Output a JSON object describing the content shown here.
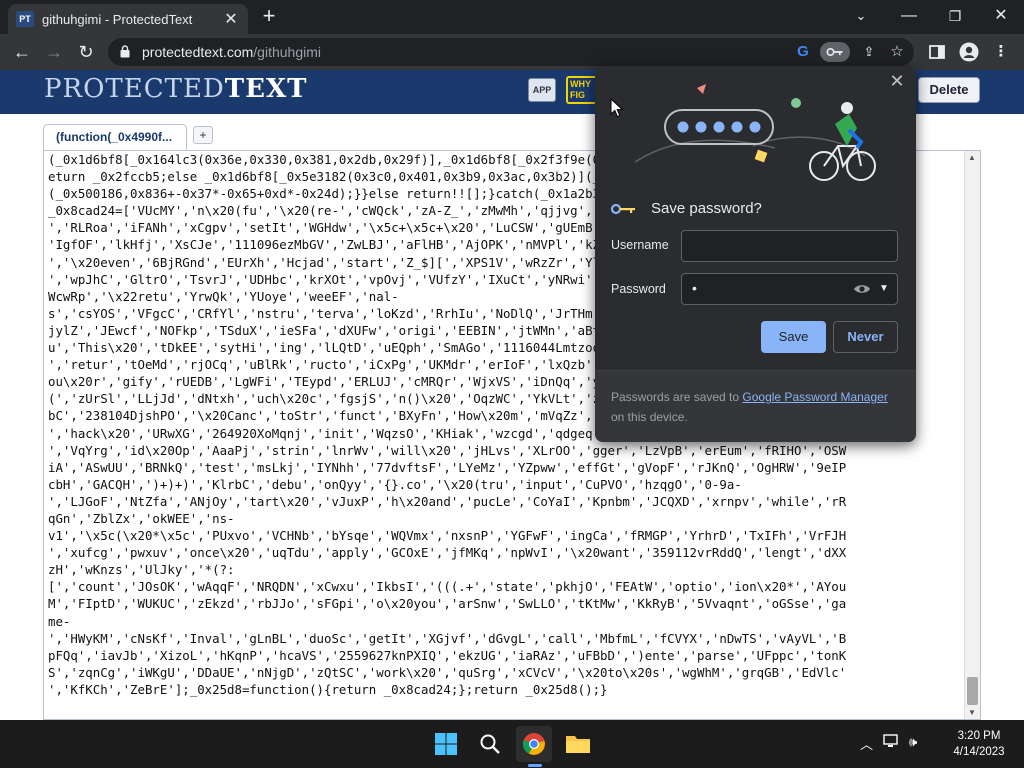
{
  "browser": {
    "tab_title": "githuhgimi - ProtectedText",
    "tab_favicon_text": "PT",
    "url_host": "protectedtext.com",
    "url_path": "/githuhgimi"
  },
  "site": {
    "logo_light": "PROTECTED",
    "logo_bold": "TEXT",
    "app_badge": "APP",
    "why_badge_line1": "WHY",
    "why_badge_line2": "FIG",
    "delete_label": "Delete",
    "doc_tab_label": "(function(_0x4990f...",
    "add_tab_label": "+"
  },
  "code_lines": [
    "(_0x1d6bf8[_0x164lc3(0x36e,0x330,0x381,0x2db,0x29f)],_0x1d6bf8[_0x2f3f9e(0x1,0x1,0x1)](_0x4f4f44))r",
    "eturn _0x2fccb5;else _0x1d6bf8[_0x5e3182(0x3c0,0x401,0x3b9,0x3ac,0x3b2)](_0x500186,0x836+-0x37*-0x65",
    "(_0x500186,0x836+-0x37*-0x65+0xd*-0x24d);}}else return!![];}catch(_0x1a2b3c){return![];}})();var ",
    "_0x8cad24=['VUcMY','n\\x20(fu','\\x20(re-','cWQck','zA-Z_','zMwMh','qjjvg','LpCrt','KhtBe','Cpzg',",
    "','RLRoa','iFANh','xCgpv','setIt','WGHdw','\\x5c+\\x5c+\\x20','LuCSW','gUEmB','KVSwj','nrwq',",
    "'IgfOF','lkHfj','XsCJe','111096ezMbGV','ZwLBJ','aFlHB','AjOPK','nMVPl','kZGtP','length','aVlNk",
    "','\\x20even','6BjRGnd','EUrXh','Hcjad','start','Z_$][','XPS1V','wRzZr','YlMMb','bCtqn','Oyq',",
    "','wpJhC','GltrO','TsvrJ','UDHbc','krXOt','vpOvj','VUfzY','IXuCt','yNRwi','aQmSd','test',",
    "WcwRp','\\x22retu','YrwQk','YUoye','weeEF','nal-",
    "s','csYOS','VFgcC','CRfYl','nstru','terva','loKzd','RrhIu','NoDlQ','JrTHm','fYnzs','bHmSr','x",
    "jylZ','JEwcf','NOFkp','TSduX','ieSFa','dXUFw','origi','EEBIN','jtWMn','aBtGc','qWvXs','iaxM",
    "u','This\\x20','tDkEE','sytHi','ing','lLQtD','uEQph','SmAGo','1116044Lmtzoo','nxtUm','sqcc'",
    "','retur','tOeMd','rjOCq','uBlRk','ructo','iCxPg','UKMdr','erIoF','lxQzb','FMWZP','kBvXz','y",
    "ou\\x20r','gify','rUEDB','LgWFi','TEypd','ERLUJ','cMRQr','WjxVS','iDnQq','yVYpA','onQtW','Z'",
    "(','zUrSl','LLjJd','dNtxh','uch\\x20c','fgsjS','n()\\x20','OqzWC','YkVLt','zHpqO','aBcde','dty",
    "bC','238104DjshPO','\\x20Canc','toStr','funct','BXyFn','How\\x20m','mVqZz','oPLMn','iJkDEPEB'",
    "','hack\\x20','URwXG','264920XoMqnj','init','WqzsO','KHiak','wzcgd','qdgeq','pLBvF','chain','e)\\x20{','HsNov",
    "','VqYrg','id\\x20Op','AaaPj','strin','lnrWv','will\\x20','jHLvs','XLrOO','gger','LzVpB','erEum','fRIHO','OSW",
    "iA','ASwUU','BRNkQ','test','msLkj','IYNhh','77dvftsF','LYeMz','YZpww','effGt','gVopF','rJKnQ','OgHRW','9eIP",
    "cbH','GACQH',')+)+)','KlrbC','debu','onQyy','{}.co','\\x20(tru','input','CuPVO','hzqgO','0-9a-",
    "','LJGoF','NtZfa','ANjOy','tart\\x20','vJuxP','h\\x20and','pucLe','CoYaI','Kpnbm','JCQXD','xrnpv','while','rR",
    "qGn','ZblZx','okWEE','ns-",
    "v1','\\x5c(\\x20*\\x5c','PUxvo','VCHNb','bYsqe','WQVmx','nxsnP','YGFwF','ingCa','fRMGP','YrhrD','TxIFh','VrFJH",
    "','xufcg','pwxuv','once\\x20','uqTdu','apply','GCOxE','jfMKq','npWvI','\\x20want','359112vrRddQ','lengt','dXX",
    "zH','wKnzs','UlJky','*(?:",
    "[','count','JOsOK','wAqqF','NRQDN','xCwxu','IkbsI','(((.+','state','pkhjO','FEAtW','optio','ion\\x20*','AYou",
    "M','FIptD','WUKUC','zEkzd','rbJJo','sFGpi','o\\x20you','arSnw','SwLLO','tKtMw','KkRyB','5Vvaqnt','oGSse','ga",
    "me-",
    "','HWyKM','cNsKf','Inval','gLnBL','duoSc','getIt','XGjvf','dGvgL','call','MbfmL','fCVYX','nDwTS','vAyVL','B",
    "pFQq','iavJb','XizoL','hKqnP','hcaVS','2559627knPXIQ','ekzUG','iaRAz','uFBbD',')ente','parse','UFppc','tonK",
    "S','zqnCg','iWKgU','DDaUE','nNjgD','zQtSC','work\\x20','quSrg','xCVcV','\\x20to\\x20s','wgWhM','grqGB','EdVlc'",
    "','KfKCh','ZeBrE'];_0x25d8=function(){return _0x8cad24;};return _0x25d8();}"
  ],
  "password_popup": {
    "title": "Save password?",
    "username_label": "Username",
    "username_value": "",
    "password_label": "Password",
    "password_value": "•",
    "save_label": "Save",
    "never_label": "Never",
    "footer_prefix": "Passwords are saved to ",
    "footer_link": "Google Password Manager",
    "footer_suffix": " on this device."
  },
  "taskbar": {
    "time": "3:20 PM",
    "date": "4/14/2023"
  },
  "colors": {
    "site_blue": "#1e3f73",
    "popup_bg": "#2b2c2f",
    "accent_blue": "#8ab4f8"
  }
}
